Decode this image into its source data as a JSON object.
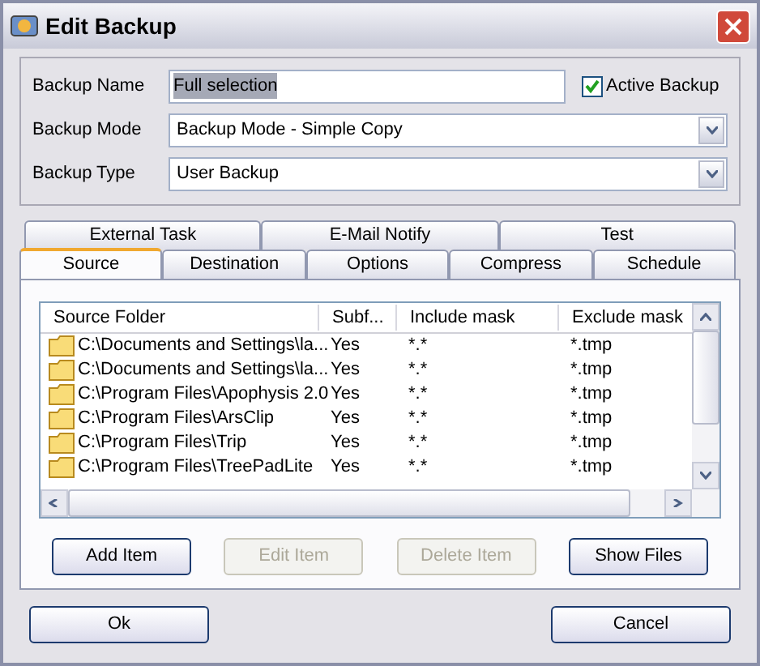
{
  "window": {
    "title": "Edit Backup"
  },
  "fields": [
    {
      "kind": "text",
      "label": "Backup Name",
      "value": "Full selection"
    },
    {
      "kind": "select",
      "label": "Backup Mode",
      "value": "Backup Mode - Simple Copy"
    },
    {
      "kind": "select",
      "label": "Backup Type",
      "value": "User Backup"
    }
  ],
  "active_backup": {
    "label": "Active Backup",
    "checked": true
  },
  "tab_rows": [
    [
      {
        "label": "External Task",
        "selected": false
      },
      {
        "label": "E-Mail Notify",
        "selected": false
      },
      {
        "label": "Test",
        "selected": false
      }
    ],
    [
      {
        "label": "Source",
        "selected": true
      },
      {
        "label": "Destination",
        "selected": false
      },
      {
        "label": "Options",
        "selected": false
      },
      {
        "label": "Compress",
        "selected": false
      },
      {
        "label": "Schedule",
        "selected": false
      }
    ]
  ],
  "table": {
    "columns": [
      "Source Folder",
      "Subf...",
      "Include mask",
      "Exclude mask"
    ],
    "rows": [
      [
        "C:\\Documents and Settings\\la...",
        "Yes",
        "*.*",
        "*.tmp"
      ],
      [
        "C:\\Documents and Settings\\la...",
        "Yes",
        "*.*",
        "*.tmp"
      ],
      [
        "C:\\Program Files\\Apophysis 2.0",
        "Yes",
        "*.*",
        "*.tmp"
      ],
      [
        "C:\\Program Files\\ArsClip",
        "Yes",
        "*.*",
        "*.tmp"
      ],
      [
        "C:\\Program Files\\Trip",
        "Yes",
        "*.*",
        "*.tmp"
      ],
      [
        "C:\\Program Files\\TreePadLite",
        "Yes",
        "*.*",
        "*.tmp"
      ]
    ]
  },
  "item_buttons": [
    {
      "label": "Add Item",
      "disabled": false
    },
    {
      "label": "Edit Item",
      "disabled": true
    },
    {
      "label": "Delete Item",
      "disabled": true
    },
    {
      "label": "Show Files",
      "disabled": false
    }
  ],
  "dialog_buttons": [
    {
      "label": "Ok"
    },
    {
      "label": "Cancel"
    }
  ]
}
